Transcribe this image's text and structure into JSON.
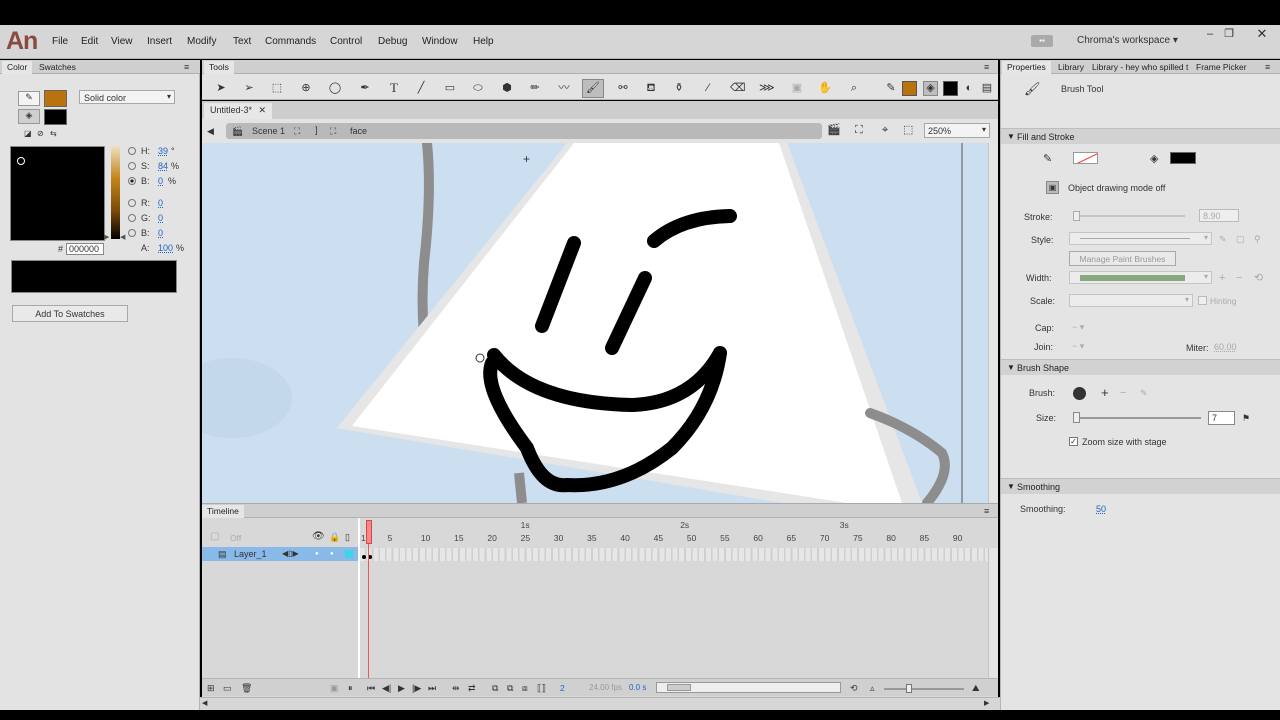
{
  "app": {
    "logo": "An",
    "workspace": "Chroma's workspace"
  },
  "menu": [
    "File",
    "Edit",
    "View",
    "Insert",
    "Modify",
    "Text",
    "Commands",
    "Control",
    "Debug",
    "Window",
    "Help"
  ],
  "color_panel": {
    "tabs": [
      "Color",
      "Swatches"
    ],
    "fill_type": "Solid color",
    "h_label": "H:",
    "h_value": "39",
    "h_unit": "°",
    "s_label": "S:",
    "s_value": "84",
    "s_unit": "%",
    "b_label": "B:",
    "b_value": "0",
    "b_unit": "%",
    "r_label": "R:",
    "r_value": "0",
    "g_label": "G:",
    "g_value": "0",
    "bl_label": "B:",
    "bl_value": "0",
    "a_label": "A:",
    "a_value": "100",
    "a_unit": "%",
    "hex_prefix": "#",
    "hex": "000000",
    "add_swatch": "Add To Swatches",
    "stroke_color": "#b8720e",
    "fill_color": "#000000"
  },
  "tools_panel": {
    "title": "Tools"
  },
  "document": {
    "tab": "Untitled-3*",
    "scene": "Scene 1",
    "symbol": "face",
    "zoom": "250%"
  },
  "timeline": {
    "title": "Timeline",
    "off_label": "Off",
    "layer": "Layer_1",
    "ticks": [
      "1",
      "5",
      "10",
      "15",
      "20",
      "25",
      "30",
      "35",
      "40",
      "45",
      "50",
      "55",
      "60",
      "65",
      "70",
      "75",
      "80",
      "85",
      "90"
    ],
    "seconds": [
      "1s",
      "2s",
      "3s"
    ],
    "current_frame": "2",
    "fps": "24.00 fps",
    "time": "0.0 s"
  },
  "properties": {
    "tabs": [
      "Properties",
      "Library",
      "Library - hey who spilled t",
      "Frame Picker"
    ],
    "tool_name": "Brush Tool",
    "fill_stroke": "Fill and Stroke",
    "object_drawing": "Object drawing mode off",
    "stroke_label": "Stroke:",
    "stroke_value": "8.90",
    "style_label": "Style:",
    "manage_brushes": "Manage Paint Brushes",
    "width_label": "Width:",
    "scale_label": "Scale:",
    "hinting": "Hinting",
    "cap_label": "Cap:",
    "join_label": "Join:",
    "miter_label": "Miter:",
    "miter_value": "60.00",
    "brush_shape": "Brush Shape",
    "brush_label": "Brush:",
    "size_label": "Size:",
    "size_value": "7",
    "zoom_size": "Zoom size with stage",
    "smoothing_section": "Smoothing",
    "smoothing_label": "Smoothing:",
    "smoothing_value": "50",
    "fill_color": "#000000"
  }
}
